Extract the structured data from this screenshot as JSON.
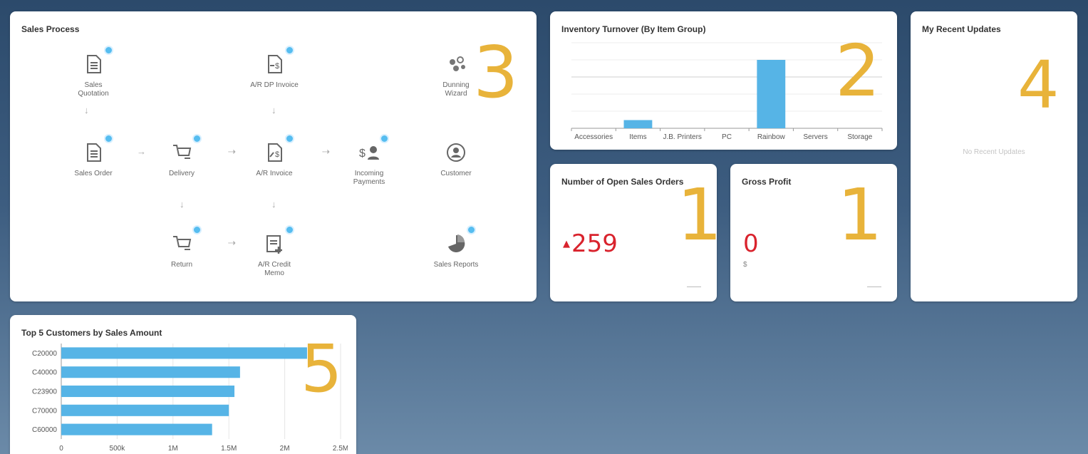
{
  "sales_process": {
    "title": "Sales Process",
    "nodes": {
      "sales_quotation": "Sales\nQuotation",
      "ar_dp_invoice": "A/R DP Invoice",
      "dunning_wizard": "Dunning\nWizard",
      "sales_order": "Sales Order",
      "delivery": "Delivery",
      "ar_invoice": "A/R Invoice",
      "incoming_payments": "Incoming\nPayments",
      "customer": "Customer",
      "return": "Return",
      "ar_credit_memo": "A/R Credit\nMemo",
      "sales_reports": "Sales Reports"
    },
    "overlay_number": "3"
  },
  "inventory": {
    "title": "Inventory Turnover (By Item Group)",
    "overlay_number": "2"
  },
  "open_orders": {
    "title": "Number of Open Sales Orders",
    "value": "259",
    "overlay_number": "1"
  },
  "gross_profit": {
    "title": "Gross Profit",
    "value": "0",
    "unit": "$",
    "overlay_number": "1"
  },
  "recent_updates": {
    "title": "My Recent Updates",
    "empty_message": "No Recent Updates",
    "overlay_number": "4"
  },
  "top5": {
    "title": "Top 5 Customers by Sales Amount",
    "overlay_number": "5"
  },
  "colors": {
    "bar": "#56b4e6",
    "badge": "#56bdf0",
    "kpi_red": "#d9232d",
    "overlay": "#e8b33a"
  },
  "chart_data": [
    {
      "type": "bar",
      "title": "Inventory Turnover (By Item Group)",
      "categories": [
        "Accessories",
        "Items",
        "J.B. Printers",
        "PC",
        "Rainbow",
        "Servers",
        "Storage"
      ],
      "values": [
        0,
        0.12,
        0,
        0,
        1.0,
        0,
        0
      ],
      "ylim": [
        0,
        1.25
      ],
      "grid": true
    },
    {
      "type": "bar",
      "orientation": "horizontal",
      "title": "Top 5 Customers by Sales Amount",
      "categories": [
        "C20000",
        "C40000",
        "C23900",
        "C70000",
        "C60000"
      ],
      "values": [
        2200000,
        1600000,
        1550000,
        1500000,
        1350000
      ],
      "xlim": [
        0,
        2500000
      ],
      "tick_labels": [
        "0",
        "500k",
        "1M",
        "1.5M",
        "2M",
        "2.5M"
      ],
      "grid": true
    }
  ]
}
